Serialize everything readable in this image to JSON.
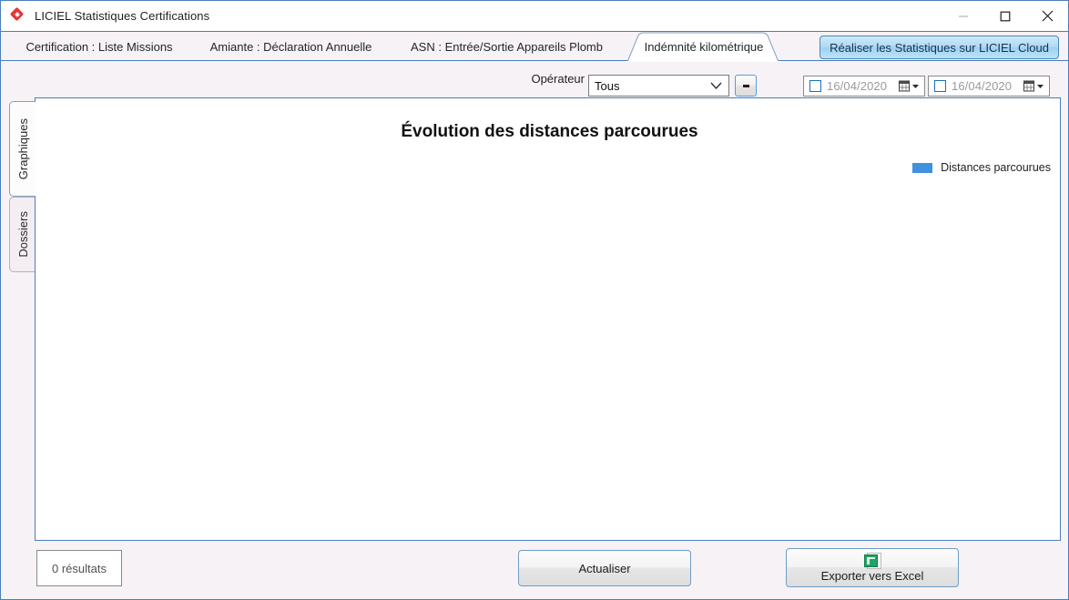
{
  "window": {
    "title": "LICIEL Statistiques Certifications",
    "app_icon": "liciel-diamond-icon",
    "controls": {
      "minimize": "minimize-icon",
      "maximize": "maximize-icon",
      "close": "close-icon"
    }
  },
  "tabs": [
    {
      "label": "Certification : Liste Missions",
      "active": false
    },
    {
      "label": "Amiante : Déclaration Annuelle",
      "active": false
    },
    {
      "label": "ASN : Entrée/Sortie Appareils Plomb",
      "active": false
    },
    {
      "label": "Indémnité kilométrique",
      "active": true
    }
  ],
  "cloud_button": {
    "label": "Réaliser les Statistiques sur LICIEL Cloud",
    "accent": "#aed9f2",
    "border": "#4a89b8"
  },
  "toolbar": {
    "operator_label": "Opérateur",
    "operator_value": "Tous",
    "operator_placeholder": "Tous",
    "minus_button_label": "-",
    "date_from": {
      "value": "16/04/2020",
      "checked": false,
      "icon": "calendar-icon"
    },
    "date_to": {
      "value": "16/04/2020",
      "checked": false,
      "icon": "calendar-icon"
    }
  },
  "side_tabs": [
    {
      "label": "Graphiques",
      "active": true
    },
    {
      "label": "Dossiers",
      "active": false
    }
  ],
  "chart_data": {
    "type": "bar",
    "title": "Évolution des distances parcourues",
    "xlabel": "",
    "ylabel": "",
    "categories": [],
    "series": [
      {
        "name": "Distances parcourues",
        "color": "#4090e0",
        "values": []
      }
    ],
    "legend": {
      "position": "top-right",
      "entries": [
        "Distances parcourues"
      ]
    },
    "grid": false,
    "empty_state": true
  },
  "footer": {
    "results_label": "0 résultats",
    "refresh_label": "Actualiser",
    "export_label": "Exporter vers Excel",
    "export_icon": "excel-icon"
  }
}
